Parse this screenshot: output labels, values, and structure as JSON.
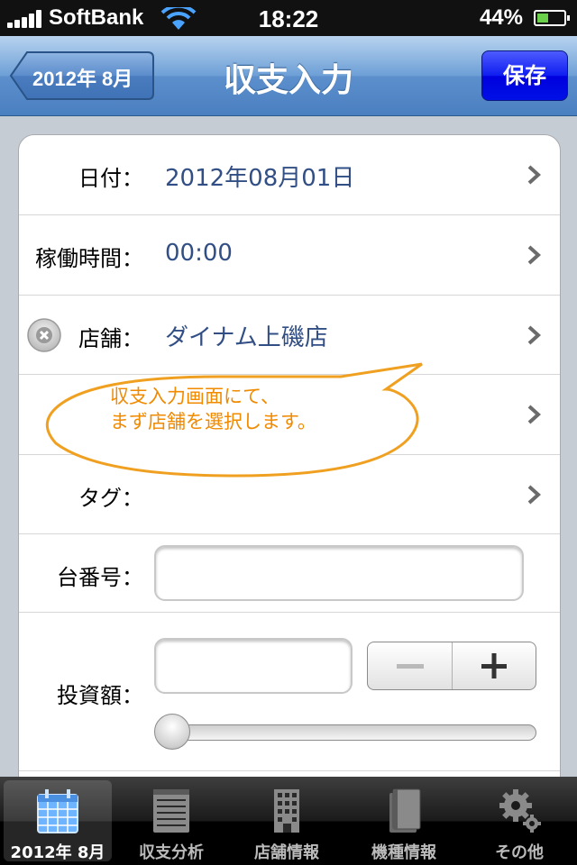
{
  "status_bar": {
    "carrier": "SoftBank",
    "time": "18:22",
    "battery": "44%",
    "battery_level": 0.44
  },
  "navbar": {
    "back_label": "2012年 8月",
    "title": "収支入力",
    "save_label": "保存",
    "save_color": "#0010e6"
  },
  "form": {
    "date": {
      "label": "日付：",
      "value": "2012年08月01日"
    },
    "hours": {
      "label": "稼働時間：",
      "value": "00:00"
    },
    "store": {
      "label": "店舗：",
      "value": "ダイナム上磯店"
    },
    "tag": {
      "label": "タグ："
    },
    "machine_no": {
      "label": "台番号：",
      "value": ""
    },
    "investment": {
      "label": "投資額：",
      "value": "",
      "stepper_minus": "−",
      "stepper_plus": "+",
      "slider_value": 0
    }
  },
  "callout": {
    "line1": "収支入力画面にて、",
    "line2": "まず店舗を選択します。",
    "color": "#f0a020"
  },
  "tabbar": {
    "tabs": [
      {
        "label": "2012年 8月",
        "icon": "calendar-icon",
        "selected": true
      },
      {
        "label": "収支分析",
        "icon": "notepad-icon",
        "selected": false
      },
      {
        "label": "店舗情報",
        "icon": "building-icon",
        "selected": false
      },
      {
        "label": "機種情報",
        "icon": "book-icon",
        "selected": false
      },
      {
        "label": "その他",
        "icon": "gear-icon",
        "selected": false
      }
    ]
  }
}
